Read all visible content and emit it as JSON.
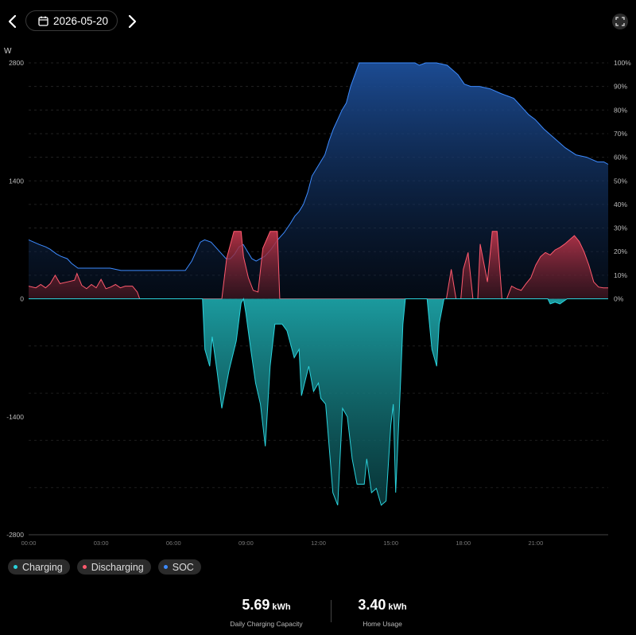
{
  "header": {
    "date": "2026-05-20",
    "prev_icon": "chevron-left-icon",
    "next_icon": "chevron-right-icon",
    "calendar_icon": "calendar-icon",
    "fullscreen_icon": "fullscreen-icon"
  },
  "legend": [
    {
      "label": "Charging",
      "color": "#2ad3dd"
    },
    {
      "label": "Discharging",
      "color": "#ff5a6e"
    },
    {
      "label": "SOC",
      "color": "#3d8bff"
    }
  ],
  "stats": {
    "charging": {
      "value": "5.69",
      "unit": "kWh",
      "label": "Daily Charging Capacity"
    },
    "home": {
      "value": "3.40",
      "unit": "kWh",
      "label": "Home Usage"
    }
  },
  "chart_data": {
    "type": "area",
    "y_unit_label": "W",
    "ylim": [
      -2800,
      2800
    ],
    "y_ticks": [
      "2800",
      "1400",
      "0",
      "-1400",
      "-2800"
    ],
    "y2lim": [
      0,
      100
    ],
    "y2_ticks": [
      "100%",
      "90%",
      "80%",
      "70%",
      "60%",
      "50%",
      "40%",
      "30%",
      "20%",
      "10%",
      "0%"
    ],
    "x_range_hours": [
      0,
      24
    ],
    "x_ticks": [
      "00:00",
      "03:00",
      "06:00",
      "09:00",
      "12:00",
      "15:00",
      "18:00",
      "21:00"
    ],
    "grid": true,
    "series": [
      {
        "name": "Charging",
        "color": "#2ad3dd",
        "points": [
          [
            0,
            0
          ],
          [
            7.2,
            0
          ],
          [
            7.3,
            -600
          ],
          [
            7.5,
            -800
          ],
          [
            7.6,
            -450
          ],
          [
            7.8,
            -850
          ],
          [
            8.0,
            -1300
          ],
          [
            8.3,
            -850
          ],
          [
            8.6,
            -500
          ],
          [
            8.8,
            -50
          ],
          [
            8.9,
            0
          ],
          [
            9.0,
            -180
          ],
          [
            9.2,
            -600
          ],
          [
            9.4,
            -1000
          ],
          [
            9.6,
            -1250
          ],
          [
            9.8,
            -1750
          ],
          [
            10.0,
            -800
          ],
          [
            10.2,
            -300
          ],
          [
            10.5,
            -300
          ],
          [
            10.7,
            -380
          ],
          [
            11.0,
            -700
          ],
          [
            11.2,
            -600
          ],
          [
            11.3,
            -1150
          ],
          [
            11.6,
            -800
          ],
          [
            11.8,
            -1100
          ],
          [
            12.0,
            -1000
          ],
          [
            12.1,
            -1180
          ],
          [
            12.3,
            -1250
          ],
          [
            12.4,
            -1600
          ],
          [
            12.6,
            -2300
          ],
          [
            12.8,
            -2450
          ],
          [
            13.0,
            -1300
          ],
          [
            13.2,
            -1400
          ],
          [
            13.4,
            -1900
          ],
          [
            13.6,
            -2200
          ],
          [
            13.9,
            -2200
          ],
          [
            14.0,
            -1900
          ],
          [
            14.2,
            -2300
          ],
          [
            14.4,
            -2250
          ],
          [
            14.6,
            -2450
          ],
          [
            14.8,
            -2400
          ],
          [
            15.0,
            -1500
          ],
          [
            15.1,
            -1250
          ],
          [
            15.2,
            -2300
          ],
          [
            15.4,
            -1000
          ],
          [
            15.5,
            -300
          ],
          [
            15.6,
            0
          ],
          [
            16.5,
            0
          ],
          [
            16.7,
            -600
          ],
          [
            16.9,
            -800
          ],
          [
            17.0,
            -300
          ],
          [
            17.2,
            0
          ],
          [
            21.5,
            0
          ],
          [
            21.6,
            -60
          ],
          [
            21.8,
            -40
          ],
          [
            22.0,
            -60
          ],
          [
            22.3,
            0
          ],
          [
            24,
            0
          ]
        ]
      },
      {
        "name": "Discharging",
        "color": "#ff5a6e",
        "points": [
          [
            0,
            150
          ],
          [
            0.3,
            130
          ],
          [
            0.5,
            170
          ],
          [
            0.7,
            130
          ],
          [
            0.9,
            180
          ],
          [
            1.1,
            280
          ],
          [
            1.3,
            180
          ],
          [
            1.6,
            200
          ],
          [
            1.9,
            220
          ],
          [
            2.0,
            300
          ],
          [
            2.2,
            160
          ],
          [
            2.4,
            120
          ],
          [
            2.6,
            170
          ],
          [
            2.8,
            130
          ],
          [
            3.0,
            230
          ],
          [
            3.2,
            120
          ],
          [
            3.4,
            140
          ],
          [
            3.6,
            170
          ],
          [
            3.8,
            130
          ],
          [
            4.0,
            150
          ],
          [
            4.3,
            150
          ],
          [
            4.5,
            80
          ],
          [
            4.6,
            0
          ],
          [
            8.0,
            0
          ],
          [
            8.2,
            480
          ],
          [
            8.5,
            800
          ],
          [
            8.8,
            800
          ],
          [
            8.9,
            500
          ],
          [
            9.1,
            250
          ],
          [
            9.3,
            100
          ],
          [
            9.5,
            80
          ],
          [
            9.7,
            600
          ],
          [
            10.0,
            800
          ],
          [
            10.1,
            800
          ],
          [
            10.3,
            800
          ],
          [
            10.4,
            0
          ],
          [
            13.0,
            0
          ],
          [
            15.0,
            0
          ],
          [
            17.3,
            0
          ],
          [
            17.5,
            350
          ],
          [
            17.7,
            0
          ],
          [
            17.9,
            0
          ],
          [
            18.0,
            350
          ],
          [
            18.2,
            550
          ],
          [
            18.4,
            0
          ],
          [
            18.6,
            0
          ],
          [
            18.7,
            650
          ],
          [
            18.9,
            350
          ],
          [
            19.0,
            200
          ],
          [
            19.2,
            800
          ],
          [
            19.4,
            800
          ],
          [
            19.6,
            0
          ],
          [
            19.8,
            0
          ],
          [
            20.0,
            150
          ],
          [
            20.2,
            120
          ],
          [
            20.4,
            100
          ],
          [
            20.6,
            180
          ],
          [
            20.8,
            250
          ],
          [
            21.0,
            400
          ],
          [
            21.2,
            500
          ],
          [
            21.4,
            550
          ],
          [
            21.6,
            520
          ],
          [
            21.8,
            580
          ],
          [
            22.0,
            610
          ],
          [
            22.2,
            650
          ],
          [
            22.4,
            700
          ],
          [
            22.6,
            750
          ],
          [
            22.8,
            680
          ],
          [
            23.0,
            560
          ],
          [
            23.2,
            400
          ],
          [
            23.4,
            200
          ],
          [
            23.6,
            140
          ],
          [
            23.8,
            130
          ],
          [
            24,
            130
          ]
        ]
      },
      {
        "name": "SOC",
        "color": "#3d8bff",
        "points": [
          [
            0,
            25
          ],
          [
            0.5,
            23
          ],
          [
            0.8,
            22
          ],
          [
            1.0,
            21
          ],
          [
            1.3,
            19
          ],
          [
            1.5,
            18
          ],
          [
            1.8,
            17
          ],
          [
            2.0,
            15
          ],
          [
            2.3,
            13
          ],
          [
            3.0,
            13
          ],
          [
            3.8,
            13
          ],
          [
            4.3,
            12
          ],
          [
            5.0,
            12
          ],
          [
            6.0,
            12
          ],
          [
            7.0,
            12
          ],
          [
            7.3,
            12
          ],
          [
            7.6,
            16
          ],
          [
            7.8,
            20
          ],
          [
            8.0,
            24
          ],
          [
            8.2,
            25
          ],
          [
            8.5,
            24
          ],
          [
            8.8,
            21
          ],
          [
            9.0,
            19
          ],
          [
            9.2,
            17
          ],
          [
            9.4,
            17
          ],
          [
            9.6,
            19
          ],
          [
            9.8,
            22
          ],
          [
            10.0,
            23
          ],
          [
            10.2,
            20
          ],
          [
            10.4,
            17
          ],
          [
            10.6,
            16
          ],
          [
            10.8,
            17
          ],
          [
            11.0,
            18
          ],
          [
            11.3,
            21
          ],
          [
            11.6,
            25
          ],
          [
            11.9,
            28
          ],
          [
            12.2,
            32
          ],
          [
            12.4,
            35
          ],
          [
            12.6,
            37
          ],
          [
            12.8,
            40
          ],
          [
            13.0,
            45
          ],
          [
            13.2,
            52
          ],
          [
            13.4,
            55
          ],
          [
            13.6,
            58
          ],
          [
            13.8,
            61
          ],
          [
            14.0,
            67
          ],
          [
            14.2,
            72
          ],
          [
            14.4,
            76
          ],
          [
            14.6,
            80
          ],
          [
            14.8,
            83
          ],
          [
            15.0,
            90
          ],
          [
            15.2,
            95
          ],
          [
            15.4,
            100
          ],
          [
            16.0,
            100
          ],
          [
            16.5,
            100
          ],
          [
            17.0,
            100
          ],
          [
            18.0,
            100
          ],
          [
            18.2,
            99
          ],
          [
            18.5,
            100
          ],
          [
            19.0,
            100
          ],
          [
            19.5,
            99
          ],
          [
            20.0,
            95
          ],
          [
            20.3,
            91
          ],
          [
            20.6,
            90
          ],
          [
            21.0,
            90
          ],
          [
            21.5,
            89
          ],
          [
            22.0,
            87
          ],
          [
            22.3,
            86
          ],
          [
            22.6,
            85
          ],
          [
            23.0,
            81
          ],
          [
            23.3,
            78
          ],
          [
            23.6,
            76
          ],
          [
            24.0,
            72
          ],
          [
            24.5,
            68
          ],
          [
            25.0,
            64
          ],
          [
            25.5,
            61
          ],
          [
            26.0,
            60
          ],
          [
            26.5,
            58
          ],
          [
            26.8,
            58
          ],
          [
            27.0,
            57
          ]
        ]
      }
    ]
  }
}
